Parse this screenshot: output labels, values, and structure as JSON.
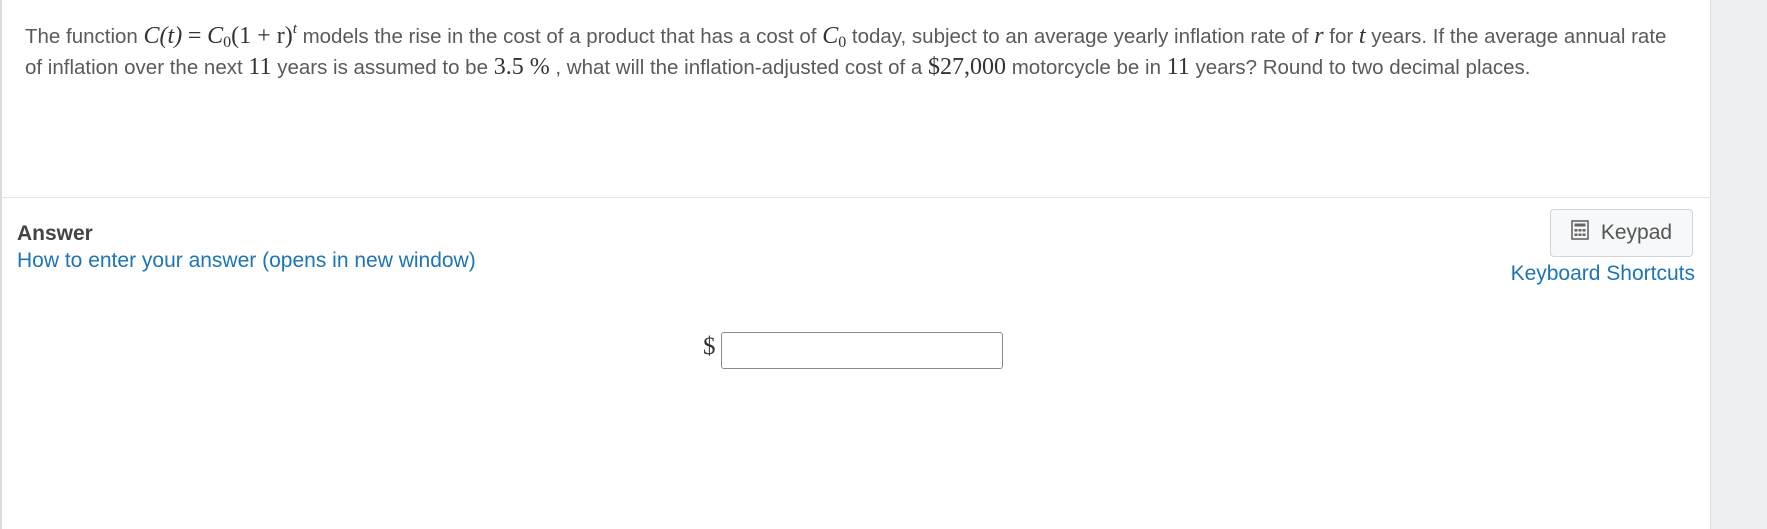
{
  "question": {
    "intro": "The function",
    "formula_lhs": "C(t)",
    "equals": "=",
    "formula_c": "C",
    "formula_sub": "0",
    "formula_paren": "(1 + r)",
    "formula_exp": "t",
    "t1": "models the rise in the cost of a product that has a cost of",
    "c0_main": "C",
    "c0_sub": "0",
    "t2": "today, subject to an average yearly inflation rate of",
    "var_r": "r",
    "t3": "for",
    "var_t": "t",
    "t4": "years.  If the average annual rate of inflation over the next",
    "num_years": "11",
    "t5": "years is assumed to be",
    "rate": "3.5 %",
    "t6": ", what will the inflation-adjusted cost of a",
    "price": "$27,000",
    "t7": "motorcycle be in",
    "num_years_2": "11",
    "t8": "years?  Round to two decimal places."
  },
  "answer": {
    "title": "Answer",
    "help_link": "How to enter your answer (opens in new window)",
    "keypad_label": "Keypad",
    "shortcuts_link": "Keyboard Shortcuts",
    "currency_prefix": "$",
    "input_value": ""
  },
  "icons": {
    "keypad": "calculator-icon"
  },
  "colors": {
    "link": "#1d74b8",
    "text": "#5a5a5a",
    "gutter": "#eef1f4"
  }
}
